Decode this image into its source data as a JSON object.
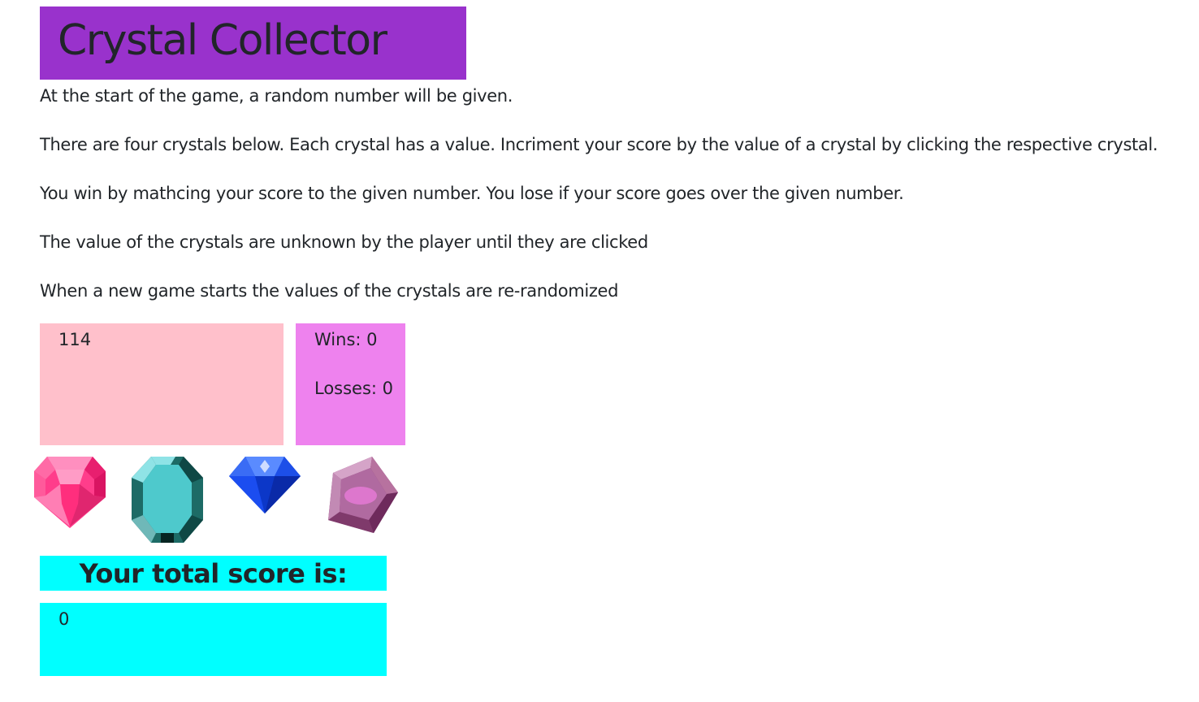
{
  "title": "Crystal Collector",
  "instructions": [
    "At the start of the game, a random number will be given.",
    "There are four crystals below. Each crystal has a value. Incriment your score by the value of a crystal by clicking the respective crystal.",
    "You win by mathcing your score to the given number. You lose if your score goes over the given number.",
    "The value of the crystals are unknown by the player until they are clicked",
    "When a new game starts the values of the crystals are re-randomized"
  ],
  "target_number": "114",
  "stats": {
    "wins": "Wins: 0",
    "losses": "Losses: 0"
  },
  "crystals": [
    {
      "icon": "pink-gem-icon",
      "color": "#ff3d8b"
    },
    {
      "icon": "teal-octagon-gem-icon",
      "color": "#4ec9cc"
    },
    {
      "icon": "blue-diamond-icon",
      "color": "#0a3fe0"
    },
    {
      "icon": "purple-pentagon-gem-icon",
      "color": "#b870a8"
    }
  ],
  "score": {
    "label": "Your total score is:",
    "value": "0"
  },
  "colors": {
    "title_bg": "#9932cc",
    "target_bg": "#ffc0cb",
    "stats_bg": "#ee82ee",
    "score_bg": "#00ffff"
  }
}
